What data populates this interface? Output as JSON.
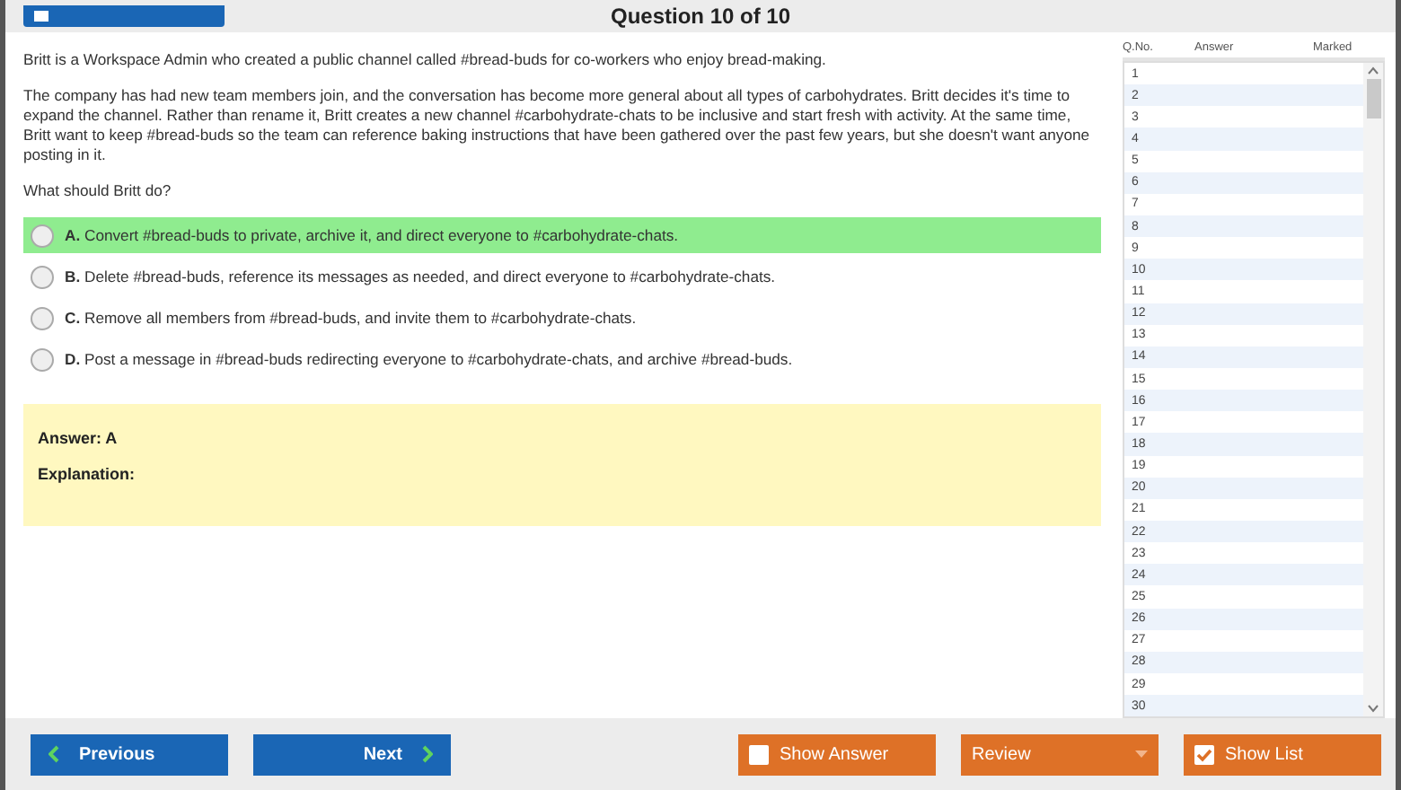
{
  "header": {
    "title": "Question 10 of 10"
  },
  "question": {
    "paragraphs": [
      "Britt is a Workspace Admin who created a public channel called #bread-buds for co-workers who enjoy bread-making.",
      "The company has had new team members join, and the conversation has become more general about all types of carbohydrates. Britt decides it's time to expand the channel. Rather than rename it, Britt creates a new channel #carbohydrate-chats to be inclusive and start fresh with activity. At the same time, Britt want to keep #bread-buds so the team can reference baking instructions that have been gathered over the past few years, but she doesn't want anyone posting in it.",
      "What should Britt do?"
    ]
  },
  "options": [
    {
      "letter": "A.",
      "text": "Convert #bread-buds to private, archive it, and direct everyone to #carbohydrate-chats.",
      "correct": true,
      "selected": false
    },
    {
      "letter": "B.",
      "text": "Delete #bread-buds, reference its messages as needed, and direct everyone to #carbohydrate-chats.",
      "correct": false,
      "selected": false
    },
    {
      "letter": "C.",
      "text": "Remove all members from #bread-buds, and invite them to #carbohydrate-chats.",
      "correct": false,
      "selected": false
    },
    {
      "letter": "D.",
      "text": "Post a message in #bread-buds redirecting everyone to #carbohydrate-chats, and archive #bread-buds.",
      "correct": false,
      "selected": false
    }
  ],
  "answer_panel": {
    "answer": "Answer: A",
    "explanation": "Explanation:"
  },
  "question_list": {
    "columns": [
      "Q.No.",
      "Answer",
      "Marked"
    ],
    "rows": [
      "1",
      "2",
      "3",
      "4",
      "5",
      "6",
      "7",
      "8",
      "9",
      "10",
      "11",
      "12",
      "13",
      "14",
      "15",
      "16",
      "17",
      "18",
      "19",
      "20",
      "21",
      "22",
      "23",
      "24",
      "25",
      "26",
      "27",
      "28",
      "29",
      "30"
    ]
  },
  "footer": {
    "previous": "Previous",
    "next": "Next",
    "show_answer": {
      "label": "Show Answer",
      "checked": false
    },
    "review": "Review",
    "show_list": {
      "label": "Show List",
      "checked": true
    }
  }
}
